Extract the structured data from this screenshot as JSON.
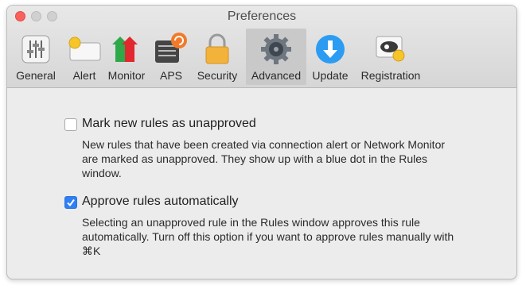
{
  "window": {
    "title": "Preferences"
  },
  "toolbar": {
    "tabs": [
      {
        "label": "General",
        "icon": "sliders-icon"
      },
      {
        "label": "Alert",
        "icon": "alert-banner-icon"
      },
      {
        "label": "Monitor",
        "icon": "monitor-arrows-icon"
      },
      {
        "label": "APS",
        "icon": "aps-refresh-icon"
      },
      {
        "label": "Security",
        "icon": "padlock-icon"
      },
      {
        "label": "Advanced",
        "icon": "gear-icon",
        "selected": true
      },
      {
        "label": "Update",
        "icon": "download-icon"
      },
      {
        "label": "Registration",
        "icon": "registration-badge-icon"
      }
    ]
  },
  "options": [
    {
      "title": "Mark new rules as unapproved",
      "checked": false,
      "description": "New rules that have been created via connection alert or Network Monitor are marked as unapproved. They show up with a blue dot in the Rules window."
    },
    {
      "title": "Approve rules automatically",
      "checked": true,
      "description": "Selecting an unapproved rule in the Rules window approves this rule automatically. Turn off this option if you want to approve rules manually with ⌘K"
    }
  ],
  "colors": {
    "accent": "#2f7ff5",
    "close": "#fc605c",
    "selected_tab": "#c9c9c9"
  }
}
